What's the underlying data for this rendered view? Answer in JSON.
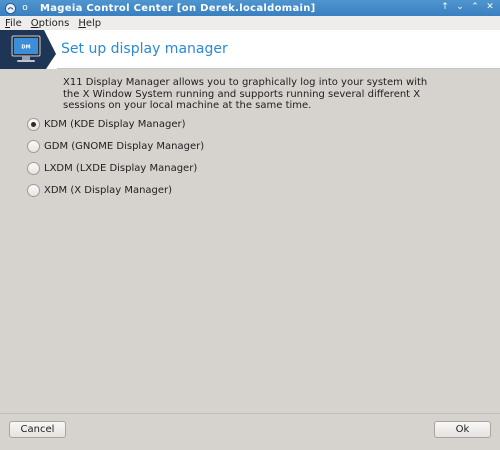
{
  "window": {
    "title": "Mageia Control Center  [on Derek.localdomain]",
    "controls": {
      "keep_above": "↑",
      "minimize": "⌄",
      "maximize": "⌃",
      "close": "✕"
    }
  },
  "menubar": {
    "items": [
      {
        "mnemonic": "F",
        "rest": "ile"
      },
      {
        "mnemonic": "O",
        "rest": "ptions"
      },
      {
        "mnemonic": "H",
        "rest": "elp"
      }
    ]
  },
  "banner": {
    "icon_label": "DM",
    "title": "Set up display manager"
  },
  "description": "X11 Display Manager allows you to graphically log into your system with the X Window System running and supports running several different X sessions on your local machine at the same time.",
  "options": [
    {
      "label": "KDM (KDE Display Manager)",
      "checked": true
    },
    {
      "label": "GDM (GNOME Display Manager)",
      "checked": false
    },
    {
      "label": "LXDM (LXDE Display Manager)",
      "checked": false
    },
    {
      "label": "XDM (X Display Manager)",
      "checked": false
    }
  ],
  "buttons": {
    "cancel": "Cancel",
    "ok": "Ok"
  },
  "colors": {
    "titlebar": "#3a7fc0",
    "banner_title": "#2a8ad4",
    "background": "#d6d3cf"
  }
}
